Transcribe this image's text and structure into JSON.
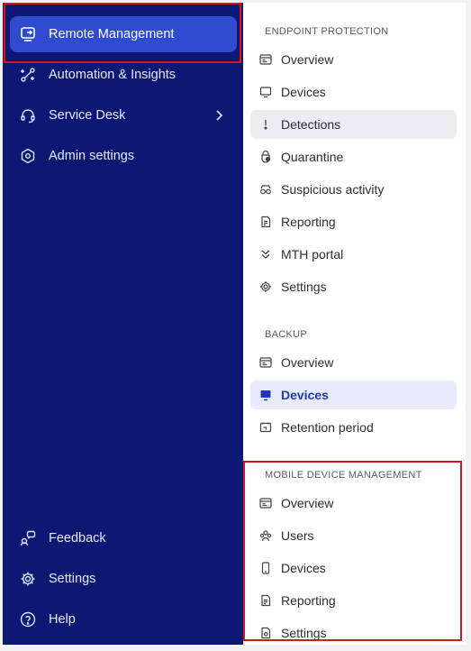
{
  "sidebar": {
    "items": [
      {
        "label": "Remote Management",
        "icon": "remote-management-icon",
        "active": true
      },
      {
        "label": "Automation & Insights",
        "icon": "automation-icon"
      },
      {
        "label": "Service Desk",
        "icon": "headset-icon"
      },
      {
        "label": "Admin settings",
        "icon": "admin-settings-icon"
      }
    ],
    "bottom": [
      {
        "label": "Feedback",
        "icon": "feedback-icon"
      },
      {
        "label": "Settings",
        "icon": "gear-icon"
      },
      {
        "label": "Help",
        "icon": "help-icon"
      }
    ]
  },
  "submenu": {
    "endpoint": {
      "title": "ENDPOINT PROTECTION",
      "items": [
        "Overview",
        "Devices",
        "Detections",
        "Quarantine",
        "Suspicious activity",
        "Reporting",
        "MTH portal",
        "Settings"
      ]
    },
    "backup": {
      "title": "BACKUP",
      "items": [
        "Overview",
        "Devices",
        "Retention period"
      ]
    },
    "mdm": {
      "title": "MOBILE DEVICE MANAGEMENT",
      "items": [
        "Overview",
        "Users",
        "Devices",
        "Reporting",
        "Settings"
      ]
    }
  },
  "colors": {
    "sidebar_bg": "#0d1875",
    "active_bg": "#2f4bcf",
    "selected_bg": "#e7ebfb",
    "selected_text": "#2238b8",
    "highlight": "#d8141d"
  }
}
